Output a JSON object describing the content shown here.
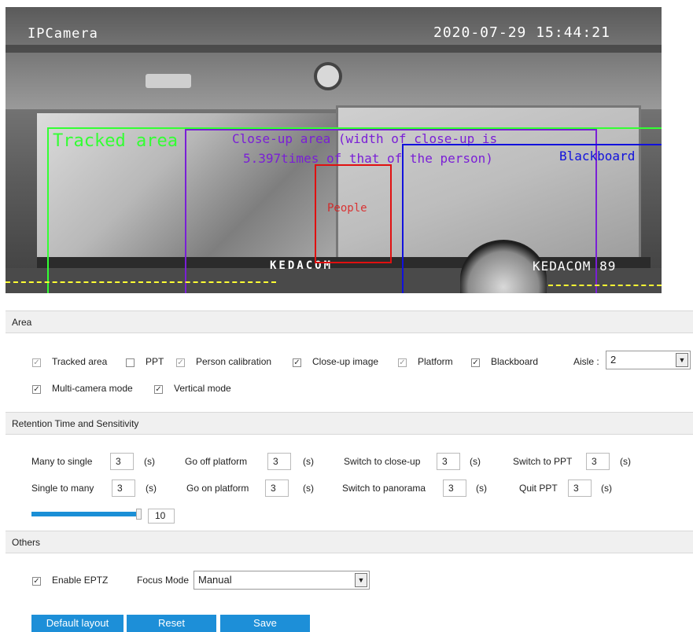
{
  "camera": {
    "name_osd": "IPCamera",
    "datetime_osd": "2020-07-29 15:44:21",
    "brand_osd": "KEDACOM 89",
    "board_brand": "KEDACOM",
    "regions": {
      "tracked_area": "Tracked area",
      "closeup_area_line1": "Close-up area (width of close-up is",
      "closeup_area_line2": "5.397times of that of the person)",
      "blackboard": "Blackboard",
      "people": "People"
    },
    "colors": {
      "tracked_area": "#33ff33",
      "closeup_area": "#7a1fd6",
      "blackboard": "#1111dd",
      "people": "#e01010",
      "platform": "#ffff33"
    }
  },
  "area_section": {
    "title": "Area",
    "checkboxes": [
      {
        "label": "Tracked area",
        "checked": true,
        "enabled": false
      },
      {
        "label": "PPT",
        "checked": false,
        "enabled": true
      },
      {
        "label": "Person calibration",
        "checked": true,
        "enabled": false
      },
      {
        "label": "Close-up image",
        "checked": true,
        "enabled": true
      },
      {
        "label": "Platform",
        "checked": true,
        "enabled": false
      },
      {
        "label": "Blackboard",
        "checked": true,
        "enabled": true
      },
      {
        "label": "Multi-camera mode",
        "checked": true,
        "enabled": true
      },
      {
        "label": "Vertical mode",
        "checked": true,
        "enabled": true
      }
    ],
    "aisle_label": "Aisle :",
    "aisle_value": "2"
  },
  "retention_section": {
    "title": "Retention Time and Sensitivity",
    "unit": "(s)",
    "fields": [
      {
        "label": "Many to single",
        "value": "3"
      },
      {
        "label": "Go off platform",
        "value": "3"
      },
      {
        "label": "Switch to close-up",
        "value": "3"
      },
      {
        "label": "Switch to PPT",
        "value": "3"
      },
      {
        "label": "Single to many",
        "value": "3"
      },
      {
        "label": "Go on platform",
        "value": "3"
      },
      {
        "label": "Switch to panorama",
        "value": "3"
      },
      {
        "label": "Quit PPT",
        "value": "3"
      }
    ],
    "sensitivity_value": "10",
    "sensitivity_fraction": 1.0
  },
  "others_section": {
    "title": "Others",
    "enable_eptz_label": "Enable EPTZ",
    "enable_eptz_checked": true,
    "focus_mode_label": "Focus Mode",
    "focus_mode_value": "Manual"
  },
  "buttons": {
    "default_layout": "Default layout",
    "reset": "Reset",
    "save": "Save"
  }
}
